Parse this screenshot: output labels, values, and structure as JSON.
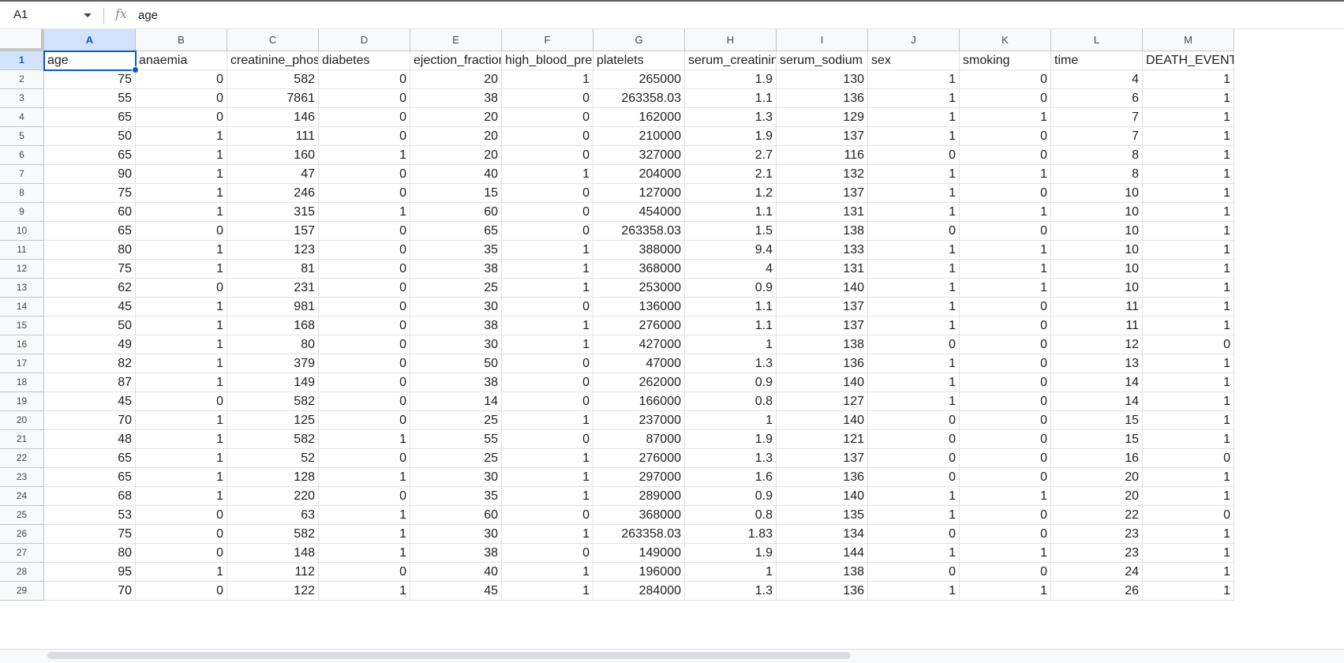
{
  "name_box": {
    "ref": "A1"
  },
  "formula_bar": {
    "fx_icon": "fx",
    "value": "age"
  },
  "columns": [
    "A",
    "B",
    "C",
    "D",
    "E",
    "F",
    "G",
    "H",
    "I",
    "J",
    "K",
    "L",
    "M"
  ],
  "selected_column": "A",
  "selected_row": "1",
  "row_numbers": [
    "1",
    "2",
    "3",
    "4",
    "5",
    "6",
    "7",
    "8",
    "9",
    "10",
    "11",
    "12",
    "13",
    "14",
    "15",
    "16",
    "17",
    "18",
    "19",
    "20",
    "21",
    "22",
    "23",
    "24",
    "25",
    "26",
    "27",
    "28",
    "29"
  ],
  "rows": [
    [
      "age",
      "anaemia",
      "creatinine_phosphokinase",
      "diabetes",
      "ejection_fraction",
      "high_blood_pressure",
      "platelets",
      "serum_creatinine",
      "serum_sodium",
      "sex",
      "smoking",
      "time",
      "DEATH_EVENT"
    ],
    [
      "75",
      "0",
      "582",
      "0",
      "20",
      "1",
      "265000",
      "1.9",
      "130",
      "1",
      "0",
      "4",
      "1"
    ],
    [
      "55",
      "0",
      "7861",
      "0",
      "38",
      "0",
      "263358.03",
      "1.1",
      "136",
      "1",
      "0",
      "6",
      "1"
    ],
    [
      "65",
      "0",
      "146",
      "0",
      "20",
      "0",
      "162000",
      "1.3",
      "129",
      "1",
      "1",
      "7",
      "1"
    ],
    [
      "50",
      "1",
      "111",
      "0",
      "20",
      "0",
      "210000",
      "1.9",
      "137",
      "1",
      "0",
      "7",
      "1"
    ],
    [
      "65",
      "1",
      "160",
      "1",
      "20",
      "0",
      "327000",
      "2.7",
      "116",
      "0",
      "0",
      "8",
      "1"
    ],
    [
      "90",
      "1",
      "47",
      "0",
      "40",
      "1",
      "204000",
      "2.1",
      "132",
      "1",
      "1",
      "8",
      "1"
    ],
    [
      "75",
      "1",
      "246",
      "0",
      "15",
      "0",
      "127000",
      "1.2",
      "137",
      "1",
      "0",
      "10",
      "1"
    ],
    [
      "60",
      "1",
      "315",
      "1",
      "60",
      "0",
      "454000",
      "1.1",
      "131",
      "1",
      "1",
      "10",
      "1"
    ],
    [
      "65",
      "0",
      "157",
      "0",
      "65",
      "0",
      "263358.03",
      "1.5",
      "138",
      "0",
      "0",
      "10",
      "1"
    ],
    [
      "80",
      "1",
      "123",
      "0",
      "35",
      "1",
      "388000",
      "9.4",
      "133",
      "1",
      "1",
      "10",
      "1"
    ],
    [
      "75",
      "1",
      "81",
      "0",
      "38",
      "1",
      "368000",
      "4",
      "131",
      "1",
      "1",
      "10",
      "1"
    ],
    [
      "62",
      "0",
      "231",
      "0",
      "25",
      "1",
      "253000",
      "0.9",
      "140",
      "1",
      "1",
      "10",
      "1"
    ],
    [
      "45",
      "1",
      "981",
      "0",
      "30",
      "0",
      "136000",
      "1.1",
      "137",
      "1",
      "0",
      "11",
      "1"
    ],
    [
      "50",
      "1",
      "168",
      "0",
      "38",
      "1",
      "276000",
      "1.1",
      "137",
      "1",
      "0",
      "11",
      "1"
    ],
    [
      "49",
      "1",
      "80",
      "0",
      "30",
      "1",
      "427000",
      "1",
      "138",
      "0",
      "0",
      "12",
      "0"
    ],
    [
      "82",
      "1",
      "379",
      "0",
      "50",
      "0",
      "47000",
      "1.3",
      "136",
      "1",
      "0",
      "13",
      "1"
    ],
    [
      "87",
      "1",
      "149",
      "0",
      "38",
      "0",
      "262000",
      "0.9",
      "140",
      "1",
      "0",
      "14",
      "1"
    ],
    [
      "45",
      "0",
      "582",
      "0",
      "14",
      "0",
      "166000",
      "0.8",
      "127",
      "1",
      "0",
      "14",
      "1"
    ],
    [
      "70",
      "1",
      "125",
      "0",
      "25",
      "1",
      "237000",
      "1",
      "140",
      "0",
      "0",
      "15",
      "1"
    ],
    [
      "48",
      "1",
      "582",
      "1",
      "55",
      "0",
      "87000",
      "1.9",
      "121",
      "0",
      "0",
      "15",
      "1"
    ],
    [
      "65",
      "1",
      "52",
      "0",
      "25",
      "1",
      "276000",
      "1.3",
      "137",
      "0",
      "0",
      "16",
      "0"
    ],
    [
      "65",
      "1",
      "128",
      "1",
      "30",
      "1",
      "297000",
      "1.6",
      "136",
      "0",
      "0",
      "20",
      "1"
    ],
    [
      "68",
      "1",
      "220",
      "0",
      "35",
      "1",
      "289000",
      "0.9",
      "140",
      "1",
      "1",
      "20",
      "1"
    ],
    [
      "53",
      "0",
      "63",
      "1",
      "60",
      "0",
      "368000",
      "0.8",
      "135",
      "1",
      "0",
      "22",
      "0"
    ],
    [
      "75",
      "0",
      "582",
      "1",
      "30",
      "1",
      "263358.03",
      "1.83",
      "134",
      "0",
      "0",
      "23",
      "1"
    ],
    [
      "80",
      "0",
      "148",
      "1",
      "38",
      "0",
      "149000",
      "1.9",
      "144",
      "1",
      "1",
      "23",
      "1"
    ],
    [
      "95",
      "1",
      "112",
      "0",
      "40",
      "1",
      "196000",
      "1",
      "138",
      "0",
      "0",
      "24",
      "1"
    ],
    [
      "70",
      "0",
      "122",
      "1",
      "45",
      "1",
      "284000",
      "1.3",
      "136",
      "1",
      "1",
      "26",
      "1"
    ]
  ],
  "colors": {
    "selection": "#0b57d0",
    "header_selected_bg": "#d3e3fd",
    "header_bg": "#f8f9fa",
    "gridline": "#e1e3e1"
  }
}
